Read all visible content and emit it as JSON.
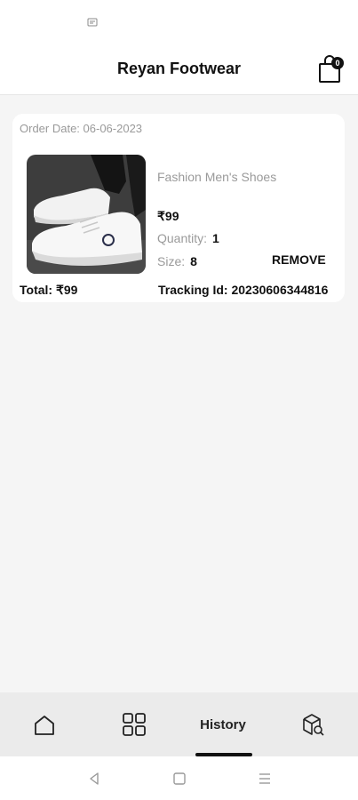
{
  "header": {
    "title": "Reyan Footwear",
    "cart_count": "0"
  },
  "order": {
    "date_label": "Order Date: 06-06-2023",
    "product_name": "Fashion Men's Shoes",
    "price": "₹99",
    "quantity_label": "Quantity:",
    "quantity_value": "1",
    "size_label": "Size:",
    "size_value": "8",
    "remove_label": "REMOVE",
    "total": "Total: ₹99",
    "tracking": "Tracking Id: 20230606344816"
  },
  "bottom_nav": {
    "items": [
      {
        "icon": "home-icon"
      },
      {
        "icon": "categories-grid-icon"
      },
      {
        "label": "History"
      },
      {
        "icon": "package-search-icon"
      }
    ],
    "active_index": 2
  },
  "system_nav": {
    "icons": [
      "back-icon",
      "home-square-icon",
      "recents-icon"
    ]
  },
  "colors": {
    "accent": "#111111",
    "muted_text": "#9a9a9a",
    "background": "#f5f5f5",
    "nav_background": "#ebebeb"
  }
}
